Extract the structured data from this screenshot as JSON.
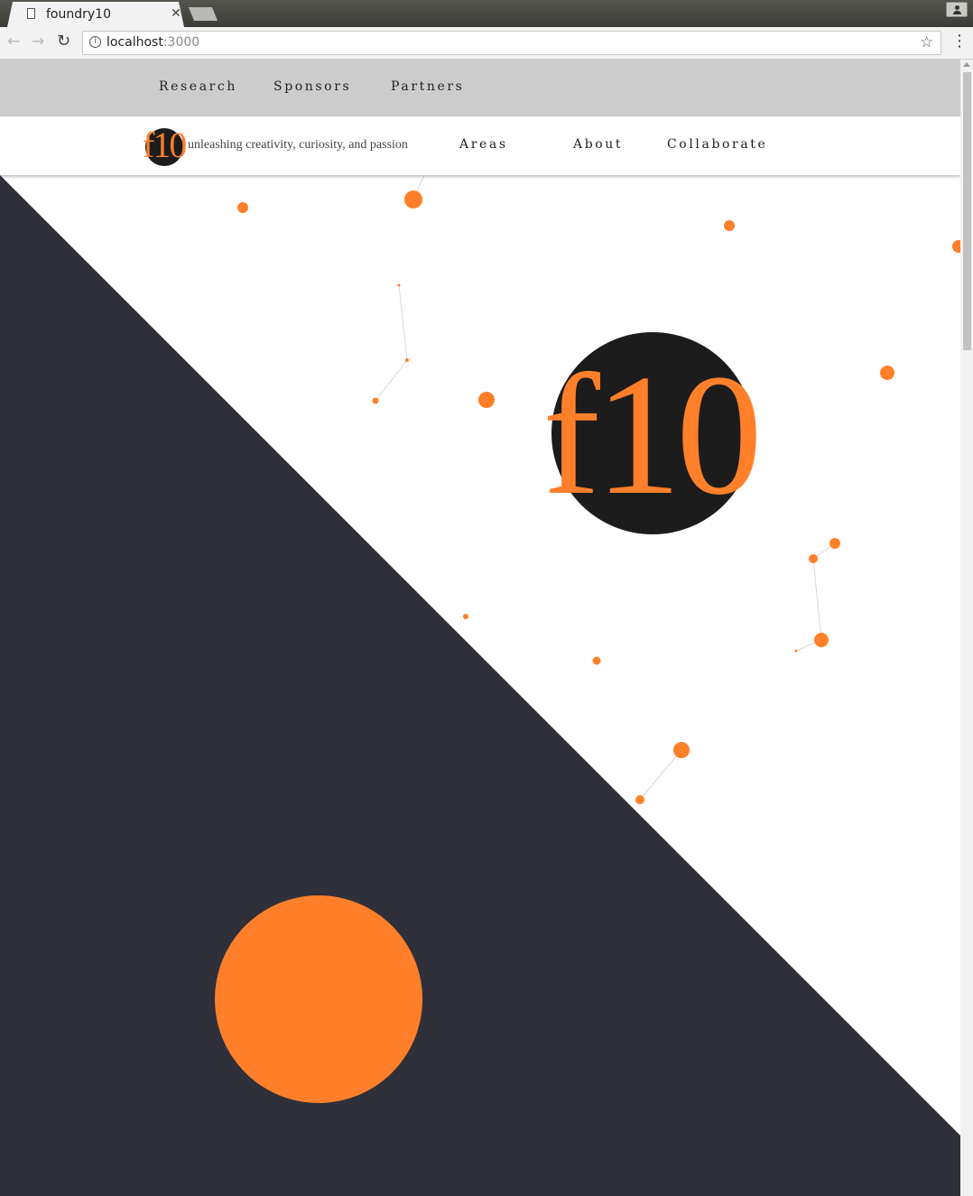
{
  "browser": {
    "tab_title": "foundry10",
    "url_host": "localhost",
    "url_port": ":3000"
  },
  "top_nav": {
    "items": [
      "Research",
      "Sponsors",
      "Partners"
    ]
  },
  "main_nav": {
    "logo_text": "f10",
    "tagline": "unleashing creativity, curiosity, and passion",
    "items": [
      "Areas",
      "About",
      "Collaborate"
    ]
  },
  "hero": {
    "logo_text": "f10"
  },
  "colors": {
    "accent": "#ff7f2a",
    "dark": "#1c1c1c",
    "slate": "#30303a",
    "top_nav_bg": "#cccccc"
  }
}
